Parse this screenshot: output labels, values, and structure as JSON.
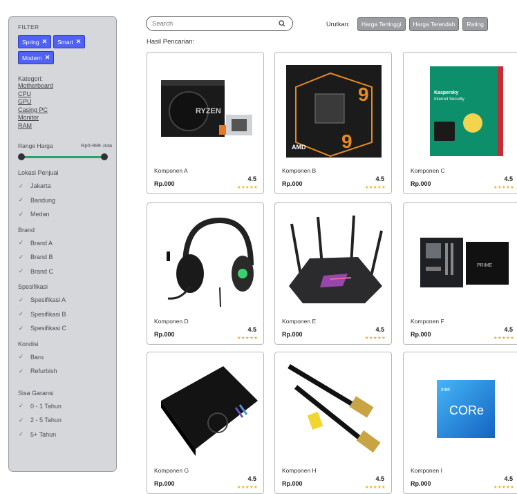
{
  "sidebar": {
    "title": "FILTER",
    "tags": [
      "Spring",
      "Smart",
      "Modern"
    ],
    "category_title": "Kategori:",
    "categories": [
      "Motherboard",
      "CPU",
      "GPU",
      "Casing PC",
      "Monitor",
      "RAM"
    ],
    "price_range_title": "Range Harga",
    "price_range_value": "Rp0-999 Juta",
    "price_range": {
      "min": 0,
      "max": 1
    },
    "groups": [
      {
        "title": "Lokasi Penjual",
        "options": [
          "Jakarta",
          "Bandung",
          "Medan"
        ]
      },
      {
        "title": "Brand",
        "options": [
          "Brand A",
          "Brand B",
          "Brand C"
        ]
      },
      {
        "title": "Spesifikasi",
        "options": [
          "Spesifikasi A",
          "Spesifikasi B",
          "Spesifikasi C"
        ]
      },
      {
        "title": "Kondisi",
        "options": [
          "Baru",
          "Refurbish"
        ]
      },
      {
        "title": "Sisa Garansi",
        "options": [
          "0 - 1 Tahun",
          "2 - 5 Tahun",
          "5+ Tahun"
        ]
      }
    ]
  },
  "search": {
    "placeholder": "Search"
  },
  "sort": {
    "label": "Urutkan:",
    "options": [
      "Harga Tertinggi",
      "Harga Terendah",
      "Rating"
    ]
  },
  "results_label": "Hasil Pencarian:",
  "products": [
    {
      "name": "Komponen A",
      "price": "Rp.000",
      "rating": "4.5",
      "stars": 4.5,
      "image": "amd-ryzen-box"
    },
    {
      "name": "Komponen B",
      "price": "Rp.000",
      "rating": "4.5",
      "stars": 4.5,
      "image": "amd-ryzen-9-box"
    },
    {
      "name": "Komponen C",
      "price": "Rp.000",
      "rating": "4.5",
      "stars": 4.5,
      "image": "kaspersky-box"
    },
    {
      "name": "Komponen D",
      "price": "Rp.000",
      "rating": "4.5",
      "stars": 4.5,
      "image": "headset"
    },
    {
      "name": "Komponen E",
      "price": "Rp.000",
      "rating": "4.5",
      "stars": 4.5,
      "image": "router"
    },
    {
      "name": "Komponen F",
      "price": "Rp.000",
      "rating": "4.5",
      "stars": 4.5,
      "image": "motherboard"
    },
    {
      "name": "Komponen G",
      "price": "Rp.000",
      "rating": "4.5",
      "stars": 4.5,
      "image": "mousepad"
    },
    {
      "name": "Komponen H",
      "price": "Rp.000",
      "rating": "4.5",
      "stars": 4.5,
      "image": "ethernet-cables"
    },
    {
      "name": "Komponen I",
      "price": "Rp.000",
      "rating": "4.5",
      "stars": 4.5,
      "image": "intel-core-box"
    }
  ],
  "images": {
    "kaspersky_box_text": "Kaspersky Internet Security",
    "intel_box_text": "CORe",
    "intel_box_small": "intel"
  },
  "colors": {
    "tag": "#4f62f5",
    "range_track": "#28a36c",
    "sort_button": "#9b9da1",
    "sidebar_bg": "#d6d7da",
    "star": "#e8b23a"
  }
}
